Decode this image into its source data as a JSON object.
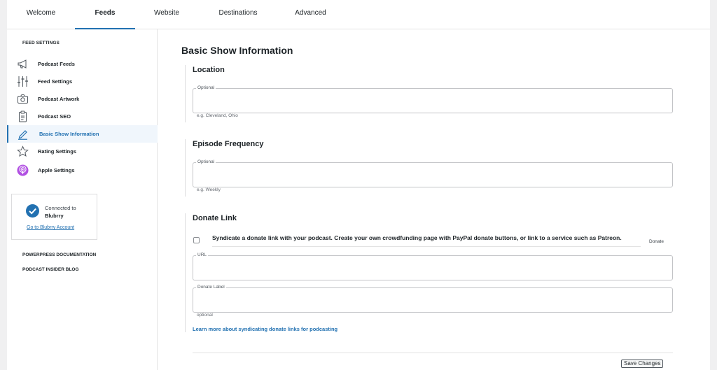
{
  "tabs": [
    {
      "label": "Welcome"
    },
    {
      "label": "Feeds",
      "active": true
    },
    {
      "label": "Website"
    },
    {
      "label": "Destinations"
    },
    {
      "label": "Advanced"
    }
  ],
  "sidebar": {
    "heading": "FEED SETTINGS",
    "items": [
      {
        "label": "Podcast Feeds",
        "icon": "megaphone-icon"
      },
      {
        "label": "Feed Settings",
        "icon": "sliders-icon"
      },
      {
        "label": "Podcast Artwork",
        "icon": "camera-icon"
      },
      {
        "label": "Podcast SEO",
        "icon": "clipboard-icon"
      },
      {
        "label": "Basic Show Information",
        "icon": "pencil-icon",
        "active": true
      },
      {
        "label": "Rating Settings",
        "icon": "star-icon"
      },
      {
        "label": "Apple Settings",
        "icon": "podcast-icon"
      }
    ],
    "connection": {
      "line1": "Connected to",
      "line2": "Blubrry",
      "link": "Go to Blubrry Account"
    },
    "links": [
      "POWERPRESS DOCUMENTATION",
      "PODCAST INSIDER BLOG"
    ]
  },
  "main": {
    "title": "Basic Show Information",
    "location": {
      "title": "Location",
      "label": "Optional",
      "value": "",
      "hint": "e.g. Cleveland, Ohio"
    },
    "frequency": {
      "title": "Episode Frequency",
      "label": "Optional",
      "value": "",
      "hint": "e.g. Weekly"
    },
    "donate": {
      "title": "Donate Link",
      "checkbox_label": "Syndicate a donate link with your podcast. Create your own crowdfunding page with PayPal donate buttons, or link to a service such as Patreon.",
      "checked": false,
      "tag": "Donate",
      "url_label": "URL",
      "url_value": "",
      "donate_label_label": "Donate Label",
      "donate_label_value": "",
      "donate_label_hint": "optional",
      "learn_more": "Learn more about syndicating donate links for podcasting"
    },
    "save_label": "Save Changes"
  },
  "colors": {
    "accent": "#2271b1",
    "badge": "#2271b1"
  }
}
